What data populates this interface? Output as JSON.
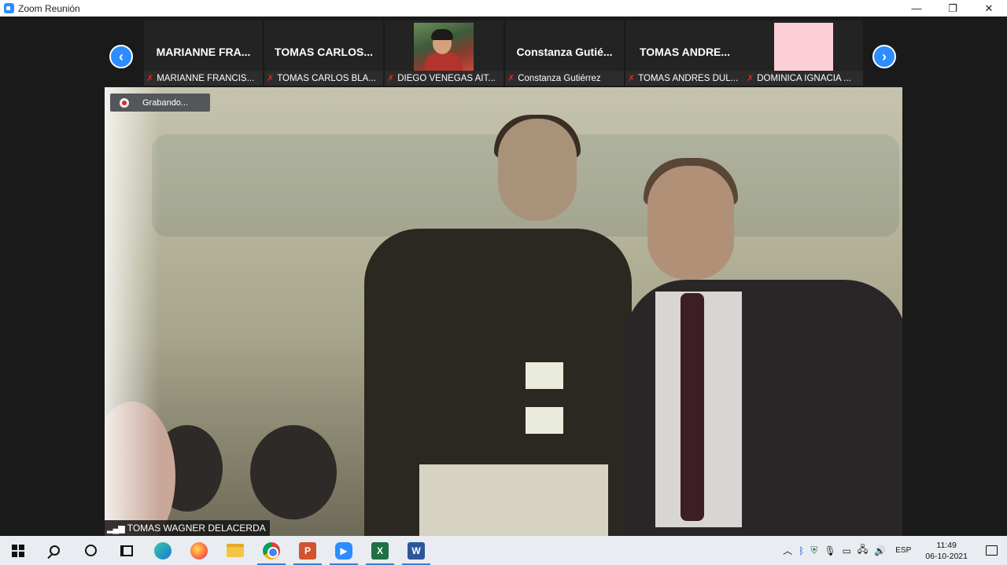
{
  "window": {
    "title": "Zoom Reunión",
    "controls": {
      "minimize": "—",
      "restore": "❐",
      "close": "✕"
    }
  },
  "strip": {
    "prev_icon": "chevron-left-icon",
    "next_icon": "chevron-right-icon",
    "tiles": [
      {
        "name_big": "MARIANNE FRA...",
        "label": "MARIANNE FRANCIS...",
        "muted": true
      },
      {
        "name_big": "TOMAS  CARLOS...",
        "label": "TOMAS CARLOS BLA...",
        "muted": true
      },
      {
        "name_big": "",
        "label": "DIEGO VENEGAS AIT...",
        "muted": true
      },
      {
        "name_big": "Constanza  Gutié...",
        "label": "Constanza Gutiérrez",
        "muted": true
      },
      {
        "name_big": "TOMAS  ANDRE...",
        "label": "TOMAS ANDRES DUL...",
        "muted": true
      },
      {
        "name_big": "",
        "label": "DOMINICA IGNACIA ...",
        "muted": true
      }
    ]
  },
  "main_video": {
    "recording_label": "Grabando...",
    "speaker_name": "TOMAS WAGNER DELACERDA"
  },
  "taskbar": {
    "apps": [
      "start",
      "search",
      "cortana",
      "task-view",
      "edge",
      "firefox",
      "file-explorer",
      "chrome",
      "powerpoint",
      "zoom",
      "excel",
      "word"
    ],
    "tray": {
      "language": "ESP",
      "time": "11:49",
      "date": "06-10-2021"
    }
  }
}
